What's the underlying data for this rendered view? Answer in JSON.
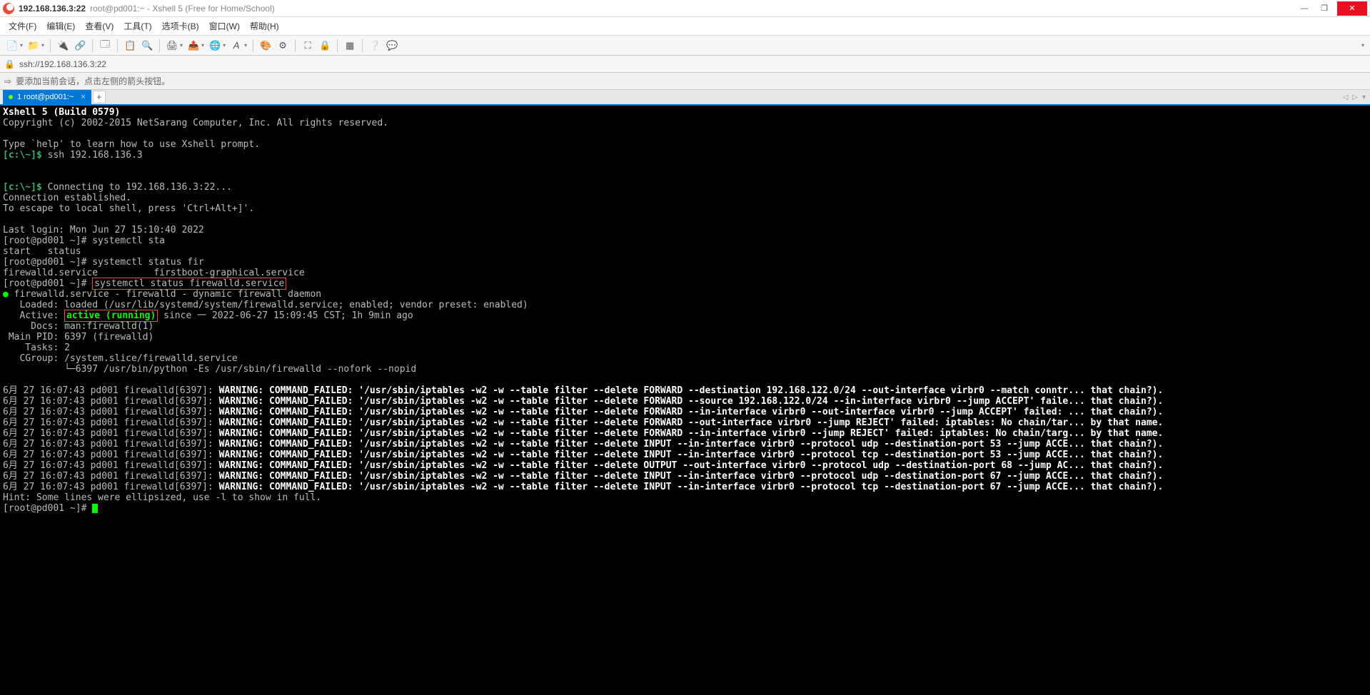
{
  "title": {
    "host": "192.168.136.3:22",
    "sub": "root@pd001:~ - Xshell 5 (Free for Home/School)"
  },
  "window_buttons": {
    "min": "—",
    "max": "❐",
    "close": "✕"
  },
  "menu": [
    "文件(F)",
    "编辑(E)",
    "查看(V)",
    "工具(T)",
    "选项卡(B)",
    "窗口(W)",
    "帮助(H)"
  ],
  "address": "ssh://192.168.136.3:22",
  "hint": "要添加当前会话，点击左侧的箭头按钮。",
  "tab": {
    "label": "1 root@pd001:~"
  },
  "term": {
    "l01": "Xshell 5 (Build 0579)",
    "l02": "Copyright (c) 2002-2015 NetSarang Computer, Inc. All rights reserved.",
    "l03": "Type `help' to learn how to use Xshell prompt.",
    "p1": "[c:\\~]$ ",
    "c1": "ssh 192.168.136.3",
    "p2": "[c:\\~]$ ",
    "c2": "Connecting to 192.168.136.3:22...",
    "l04": "Connection established.",
    "l05": "To escape to local shell, press 'Ctrl+Alt+]'.",
    "l06": "Last login: Mon Jun 27 15:10:40 2022",
    "l07": "[root@pd001 ~]# systemctl sta",
    "l08": "start   status",
    "l09": "[root@pd001 ~]# systemctl status fir",
    "l10": "firewalld.service          firstboot-graphical.service",
    "l11a": "[root@pd001 ~]# ",
    "l11b": "systemctl status firewalld.service",
    "svc01": "firewalld.service - firewalld - dynamic firewall daemon",
    "svc02": "   Loaded: loaded (/usr/lib/systemd/system/firewalld.service; enabled; vendor preset: enabled)",
    "svc03a": "   Active: ",
    "svc03b": "active (running)",
    "svc03c": " since 一 2022-06-27 15:09:45 CST; 1h 9min ago",
    "svc04": "     Docs: man:firewalld(1)",
    "svc05": " Main PID: 6397 (firewalld)",
    "svc06": "    Tasks: 2",
    "svc07": "   CGroup: /system.slice/firewalld.service",
    "svc08": "           └─6397 /usr/bin/python -Es /usr/sbin/firewalld --nofork --nopid",
    "log_prefix": "6月 27 16:07:43 pd001 firewalld[6397]: ",
    "logs": [
      "WARNING: COMMAND_FAILED: '/usr/sbin/iptables -w2 -w --table filter --delete FORWARD --destination 192.168.122.0/24 --out-interface virbr0 --match conntr... that chain?).",
      "WARNING: COMMAND_FAILED: '/usr/sbin/iptables -w2 -w --table filter --delete FORWARD --source 192.168.122.0/24 --in-interface virbr0 --jump ACCEPT' faile... that chain?).",
      "WARNING: COMMAND_FAILED: '/usr/sbin/iptables -w2 -w --table filter --delete FORWARD --in-interface virbr0 --out-interface virbr0 --jump ACCEPT' failed: ... that chain?).",
      "WARNING: COMMAND_FAILED: '/usr/sbin/iptables -w2 -w --table filter --delete FORWARD --out-interface virbr0 --jump REJECT' failed: iptables: No chain/tar... by that name.",
      "WARNING: COMMAND_FAILED: '/usr/sbin/iptables -w2 -w --table filter --delete FORWARD --in-interface virbr0 --jump REJECT' failed: iptables: No chain/targ... by that name.",
      "WARNING: COMMAND_FAILED: '/usr/sbin/iptables -w2 -w --table filter --delete INPUT --in-interface virbr0 --protocol udp --destination-port 53 --jump ACCE... that chain?).",
      "WARNING: COMMAND_FAILED: '/usr/sbin/iptables -w2 -w --table filter --delete INPUT --in-interface virbr0 --protocol tcp --destination-port 53 --jump ACCE... that chain?).",
      "WARNING: COMMAND_FAILED: '/usr/sbin/iptables -w2 -w --table filter --delete OUTPUT --out-interface virbr0 --protocol udp --destination-port 68 --jump AC... that chain?).",
      "WARNING: COMMAND_FAILED: '/usr/sbin/iptables -w2 -w --table filter --delete INPUT --in-interface virbr0 --protocol udp --destination-port 67 --jump ACCE... that chain?).",
      "WARNING: COMMAND_FAILED: '/usr/sbin/iptables -w2 -w --table filter --delete INPUT --in-interface virbr0 --protocol tcp --destination-port 67 --jump ACCE... that chain?)."
    ],
    "hint": "Hint: Some lines were ellipsized, use -l to show in full.",
    "prompt_end": "[root@pd001 ~]# "
  }
}
